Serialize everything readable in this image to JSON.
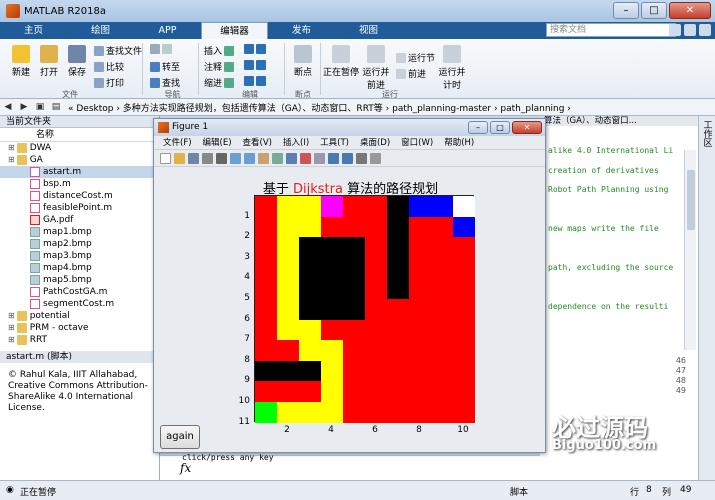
{
  "window": {
    "title": "MATLAB R2018a"
  },
  "tabs": [
    "主页",
    "绘图",
    "APP",
    "编辑器",
    "发布",
    "视图"
  ],
  "active_tab": 3,
  "search_placeholder": "搜索文档",
  "ribbon": {
    "new": "新建",
    "open": "打开",
    "save": "保存",
    "find_files": "查找文件",
    "compare": "比较",
    "print": "打印",
    "goto": "转至",
    "find": "查找",
    "insert": "插入",
    "comment": "注释",
    "indent": "缩进",
    "breakpoint": "断点",
    "run_pause": "正在暂停",
    "run_advance": "运行并前进",
    "run_section": "运行节",
    "advance": "前进",
    "run_time": "运行并计时",
    "groups": {
      "file": "文件",
      "nav": "导航",
      "edit": "编辑",
      "breakpoint": "断点",
      "run": "运行"
    }
  },
  "address": {
    "path": "« Desktop › 多种方法实现路径规划，包括遗传算法（GA）、动态窗口、RRT等 › path_planning-master › path_planning ›"
  },
  "file_browser": {
    "header": "当前文件夹",
    "col_name": "名称",
    "items": [
      {
        "name": "DWA",
        "kind": "folder",
        "indent": 0
      },
      {
        "name": "GA",
        "kind": "folder",
        "indent": 0
      },
      {
        "name": "astart.m",
        "kind": "m",
        "indent": 1,
        "selected": true
      },
      {
        "name": "bsp.m",
        "kind": "m",
        "indent": 1
      },
      {
        "name": "distanceCost.m",
        "kind": "m",
        "indent": 1
      },
      {
        "name": "feasiblePoint.m",
        "kind": "m",
        "indent": 1
      },
      {
        "name": "GA.pdf",
        "kind": "pdf",
        "indent": 1
      },
      {
        "name": "map1.bmp",
        "kind": "bmp",
        "indent": 1
      },
      {
        "name": "map2.bmp",
        "kind": "bmp",
        "indent": 1
      },
      {
        "name": "map3.bmp",
        "kind": "bmp",
        "indent": 1
      },
      {
        "name": "map4.bmp",
        "kind": "bmp",
        "indent": 1
      },
      {
        "name": "map5.bmp",
        "kind": "bmp",
        "indent": 1
      },
      {
        "name": "PathCostGA.m",
        "kind": "m",
        "indent": 1
      },
      {
        "name": "segmentCost.m",
        "kind": "m",
        "indent": 1
      },
      {
        "name": "potential",
        "kind": "folder",
        "indent": 0
      },
      {
        "name": "PRM - octave",
        "kind": "folder",
        "indent": 0
      },
      {
        "name": "RRT",
        "kind": "folder",
        "indent": 0
      }
    ]
  },
  "details": {
    "header": "astart.m  (脚本)",
    "text": "© Rahul Kala, IIIT Allahabad, Creative Commons Attribution-ShareAlike 4.0 International License."
  },
  "editor_tab": "算法（GA）、动态窗口...",
  "code_lines": [
    "alike 4.0 International Li",
    " creation of derivatives",
    "Robot Path Planning using",
    "",
    "new maps write the file",
    "",
    "path, excluding the source",
    "",
    "dependence on the resulti"
  ],
  "line_numbers": [
    "46",
    "47",
    "48",
    "49"
  ],
  "sidebar_label": "工作区",
  "command": {
    "prompt_text": "click/press any key",
    "fx": "fx"
  },
  "status": {
    "left": "正在暂停",
    "type": "脚本",
    "row_label": "行",
    "row": "8",
    "col_label": "列",
    "col": "49"
  },
  "figure": {
    "title": "Figure 1",
    "menu": [
      "文件(F)",
      "编辑(E)",
      "查看(V)",
      "插入(I)",
      "工具(T)",
      "桌面(D)",
      "窗口(W)",
      "帮助(H)"
    ],
    "plot_title_pre": "基于",
    "plot_title_red": "Dijkstra",
    "plot_title_post": "算法的路径规划",
    "again_label": "again",
    "y_ticks": [
      "1",
      "2",
      "3",
      "4",
      "5",
      "6",
      "7",
      "8",
      "9",
      "10",
      "11"
    ],
    "x_ticks": [
      "2",
      "4",
      "6",
      "8",
      "10"
    ]
  },
  "chart_data": {
    "type": "heatmap",
    "title": "基于 Dijkstra 算法的路径规划",
    "x_ticks": [
      2,
      4,
      6,
      8,
      10
    ],
    "y_ticks": [
      1,
      2,
      3,
      4,
      5,
      6,
      7,
      8,
      9,
      10,
      11
    ],
    "rows": 11,
    "cols": 10,
    "palette": {
      "R": "#ff0000",
      "Y": "#ffff00",
      "K": "#000000",
      "M": "#ff00ff",
      "B": "#0000ff",
      "W": "#ffffff",
      "G": "#00ff00"
    },
    "grid": [
      "RYYMRRKBBW",
      "RYYRRRKRRB",
      "RYKKKRKRRR",
      "RYKKKRKRRR",
      "RYKKKRKRRR",
      "RYKKKRRRRR",
      "RYYRRRRRRR",
      "RRYYRRRRRR",
      "KKKYRRRRRR",
      "RRRYRRRRRR",
      "GYYYRRRRRR"
    ]
  },
  "watermark": {
    "main": "必过源码",
    "sub": "Biguo100.com"
  }
}
